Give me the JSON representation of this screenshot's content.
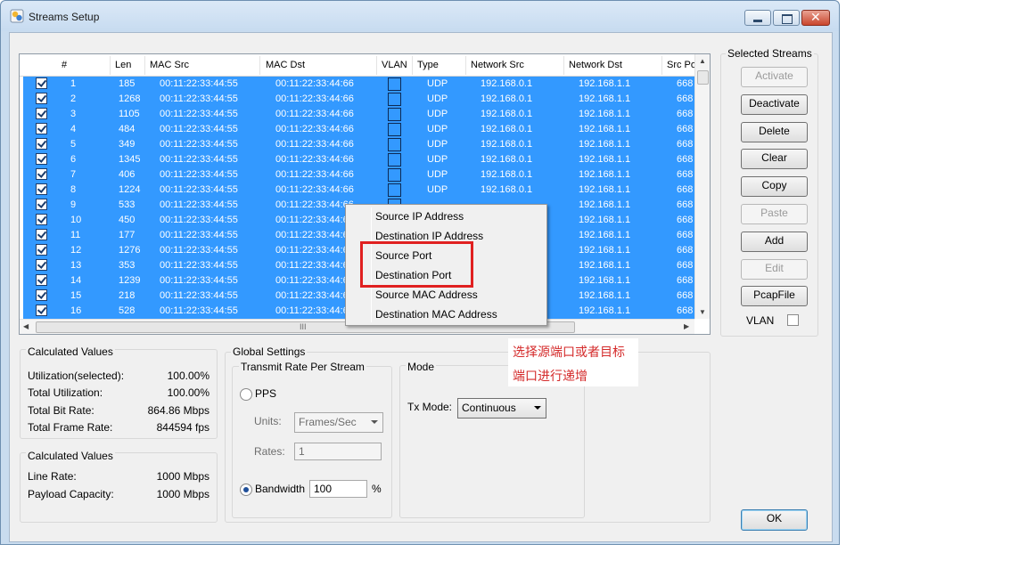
{
  "window": {
    "title": "Streams Setup"
  },
  "table": {
    "columns": [
      "#",
      "Len",
      "MAC Src",
      "MAC Dst",
      "VLAN",
      "Type",
      "Network Src",
      "Network Dst",
      "Src Po"
    ],
    "rows": [
      {
        "n": "1",
        "len": "185",
        "mac_src": "00:11:22:33:44:55",
        "mac_dst": "00:11:22:33:44:66",
        "type": "UDP",
        "net_src": "192.168.0.1",
        "net_dst": "192.168.1.1",
        "src_port": "668"
      },
      {
        "n": "2",
        "len": "1268",
        "mac_src": "00:11:22:33:44:55",
        "mac_dst": "00:11:22:33:44:66",
        "type": "UDP",
        "net_src": "192.168.0.1",
        "net_dst": "192.168.1.1",
        "src_port": "668"
      },
      {
        "n": "3",
        "len": "1105",
        "mac_src": "00:11:22:33:44:55",
        "mac_dst": "00:11:22:33:44:66",
        "type": "UDP",
        "net_src": "192.168.0.1",
        "net_dst": "192.168.1.1",
        "src_port": "668"
      },
      {
        "n": "4",
        "len": "484",
        "mac_src": "00:11:22:33:44:55",
        "mac_dst": "00:11:22:33:44:66",
        "type": "UDP",
        "net_src": "192.168.0.1",
        "net_dst": "192.168.1.1",
        "src_port": "668"
      },
      {
        "n": "5",
        "len": "349",
        "mac_src": "00:11:22:33:44:55",
        "mac_dst": "00:11:22:33:44:66",
        "type": "UDP",
        "net_src": "192.168.0.1",
        "net_dst": "192.168.1.1",
        "src_port": "668"
      },
      {
        "n": "6",
        "len": "1345",
        "mac_src": "00:11:22:33:44:55",
        "mac_dst": "00:11:22:33:44:66",
        "type": "UDP",
        "net_src": "192.168.0.1",
        "net_dst": "192.168.1.1",
        "src_port": "668"
      },
      {
        "n": "7",
        "len": "406",
        "mac_src": "00:11:22:33:44:55",
        "mac_dst": "00:11:22:33:44:66",
        "type": "UDP",
        "net_src": "192.168.0.1",
        "net_dst": "192.168.1.1",
        "src_port": "668"
      },
      {
        "n": "8",
        "len": "1224",
        "mac_src": "00:11:22:33:44:55",
        "mac_dst": "00:11:22:33:44:66",
        "type": "UDP",
        "net_src": "192.168.0.1",
        "net_dst": "192.168.1.1",
        "src_port": "668"
      },
      {
        "n": "9",
        "len": "533",
        "mac_src": "00:11:22:33:44:55",
        "mac_dst": "00:11:22:33:44:66",
        "type": "",
        "net_src": "",
        "net_dst": "192.168.1.1",
        "src_port": "668"
      },
      {
        "n": "10",
        "len": "450",
        "mac_src": "00:11:22:33:44:55",
        "mac_dst": "00:11:22:33:44:6",
        "type": "",
        "net_src": "",
        "net_dst": "192.168.1.1",
        "src_port": "668"
      },
      {
        "n": "11",
        "len": "177",
        "mac_src": "00:11:22:33:44:55",
        "mac_dst": "00:11:22:33:44:6",
        "type": "",
        "net_src": "",
        "net_dst": "192.168.1.1",
        "src_port": "668"
      },
      {
        "n": "12",
        "len": "1276",
        "mac_src": "00:11:22:33:44:55",
        "mac_dst": "00:11:22:33:44:6",
        "type": "",
        "net_src": "",
        "net_dst": "192.168.1.1",
        "src_port": "668"
      },
      {
        "n": "13",
        "len": "353",
        "mac_src": "00:11:22:33:44:55",
        "mac_dst": "00:11:22:33:44:6",
        "type": "",
        "net_src": "",
        "net_dst": "192.168.1.1",
        "src_port": "668"
      },
      {
        "n": "14",
        "len": "1239",
        "mac_src": "00:11:22:33:44:55",
        "mac_dst": "00:11:22:33:44:6",
        "type": "",
        "net_src": "",
        "net_dst": "192.168.1.1",
        "src_port": "668"
      },
      {
        "n": "15",
        "len": "218",
        "mac_src": "00:11:22:33:44:55",
        "mac_dst": "00:11:22:33:44:6",
        "type": "",
        "net_src": "",
        "net_dst": "192.168.1.1",
        "src_port": "668"
      },
      {
        "n": "16",
        "len": "528",
        "mac_src": "00:11:22:33:44:55",
        "mac_dst": "00:11:22:33:44:6",
        "type": "",
        "net_src": "",
        "net_dst": "192.168.1.1",
        "src_port": "668"
      }
    ],
    "hscroll_grip": "III"
  },
  "context_menu": {
    "items": [
      "Source IP Address",
      "Destination IP Address",
      "Source Port",
      "Destination Port",
      "Source MAC Address",
      "Destination  MAC Address"
    ]
  },
  "selected_streams": {
    "label": "Selected Streams",
    "buttons": [
      {
        "label": "Activate",
        "enabled": false
      },
      {
        "label": "Deactivate",
        "enabled": true
      },
      {
        "label": "Delete",
        "enabled": true
      },
      {
        "label": "Clear",
        "enabled": true
      },
      {
        "label": "Copy",
        "enabled": true
      },
      {
        "label": "Paste",
        "enabled": false
      },
      {
        "label": "Add",
        "enabled": true
      },
      {
        "label": "Edit",
        "enabled": false
      },
      {
        "label": "PcapFile",
        "enabled": true
      }
    ],
    "vlan_label": "VLAN"
  },
  "calculated_values": {
    "label": "Calculated Values",
    "utilization_selected_label": "Utilization(selected):",
    "utilization_selected": "100.00%",
    "total_utilization_label": "Total Utilization:",
    "total_utilization": "100.00%",
    "total_bit_rate_label": "Total Bit Rate:",
    "total_bit_rate": "864.86 Mbps",
    "total_frame_rate_label": "Total Frame Rate:",
    "total_frame_rate": "844594 fps"
  },
  "calculated_values_2": {
    "label": "Calculated Values",
    "line_rate_label": "Line Rate:",
    "line_rate": "1000 Mbps",
    "payload_capacity_label": "Payload Capacity:",
    "payload_capacity": "1000 Mbps"
  },
  "global_settings": {
    "label": "Global Settings",
    "transmit_label": "Transmit Rate Per Stream",
    "pps_label": "PPS",
    "units_label": "Units:",
    "units_value": "Frames/Sec",
    "rates_label": "Rates:",
    "rates_value": "1",
    "bandwidth_label": "Bandwidth",
    "bandwidth_value": "100",
    "bandwidth_unit": "%"
  },
  "mode": {
    "label": "Mode",
    "tx_mode_label": "Tx Mode:",
    "tx_mode_value": "Continuous"
  },
  "ok_label": "OK",
  "annotation": {
    "line1": "选择源端口或者目标",
    "line2": "端口进行递增",
    "color": "#d42a2a"
  },
  "colors": {
    "selection": "#3399ff",
    "highlight_box": "#e02020"
  }
}
